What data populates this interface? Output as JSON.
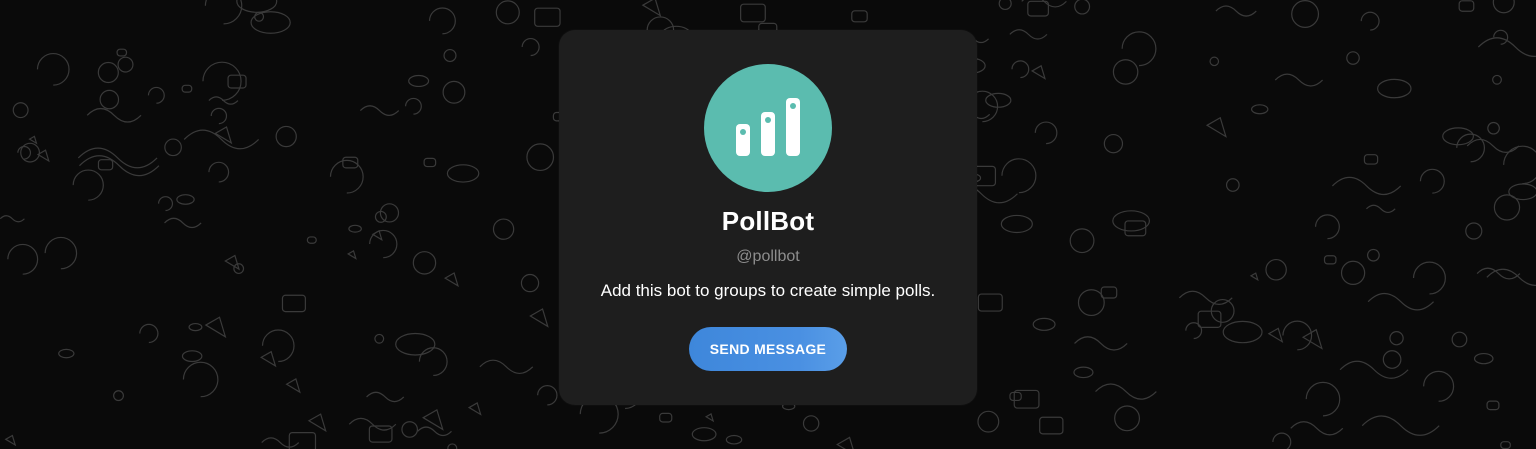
{
  "bot": {
    "name": "PollBot",
    "username": "@pollbot",
    "description": "Add this bot to groups to create simple polls.",
    "avatar_icon": "bar-chart-icon",
    "avatar_color": "#5bbcaf"
  },
  "actions": {
    "send_message_label": "SEND MESSAGE",
    "button_color": "#4a90e2"
  },
  "background": {
    "color": "#0a0a0a",
    "pattern": "doodle-pattern"
  }
}
